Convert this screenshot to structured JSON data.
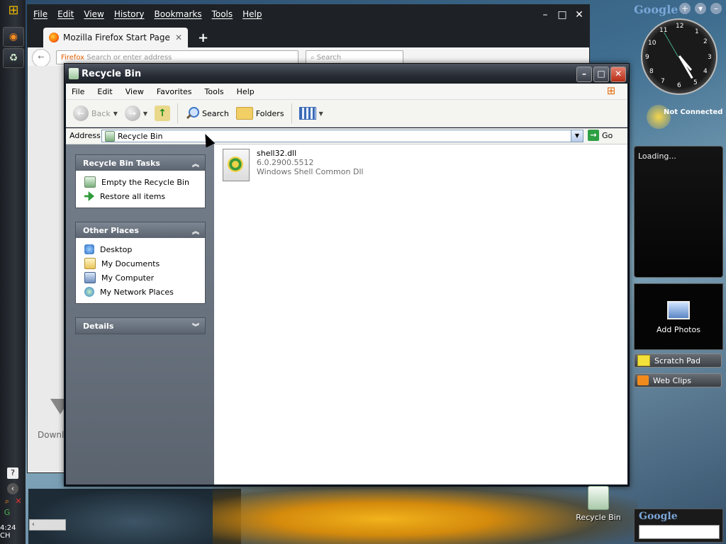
{
  "firefox": {
    "menu": [
      "File",
      "Edit",
      "View",
      "History",
      "Bookmarks",
      "Tools",
      "Help"
    ],
    "tab_title": "Mozilla Firefox Start Page",
    "url_placeholder": "Search or enter address",
    "url_prefix": "Firefox",
    "search_placeholder": "Search",
    "download_label": "Downl"
  },
  "explorer": {
    "title": "Recycle Bin",
    "menu": [
      "File",
      "Edit",
      "View",
      "Favorites",
      "Tools",
      "Help"
    ],
    "toolbar": {
      "back": "Back",
      "search": "Search",
      "folders": "Folders"
    },
    "address": {
      "label": "Address",
      "value": "Recycle Bin",
      "go": "Go"
    },
    "tasks_panel": {
      "title": "Recycle Bin Tasks",
      "items": [
        "Empty the Recycle Bin",
        "Restore all items"
      ]
    },
    "places_panel": {
      "title": "Other Places",
      "items": [
        "Desktop",
        "My Documents",
        "My Computer",
        "My Network Places"
      ]
    },
    "details_panel": {
      "title": "Details"
    },
    "files": [
      {
        "name": "shell32.dll",
        "version": "6.0.2900.5512",
        "description": "Windows Shell Common Dll"
      }
    ]
  },
  "sidebar": {
    "google": "Google",
    "clock_numbers": [
      "12",
      "1",
      "2",
      "3",
      "4",
      "5",
      "6",
      "7",
      "8",
      "9",
      "10",
      "11"
    ],
    "status": "Not Connected",
    "loading": "Loading...",
    "add_photos": "Add Photos",
    "scratch_pad": "Scratch Pad",
    "web_clips": "Web Clips"
  },
  "desktop": {
    "recycle_bin_label": "Recycle Bin",
    "clock": "4:24 CH"
  }
}
